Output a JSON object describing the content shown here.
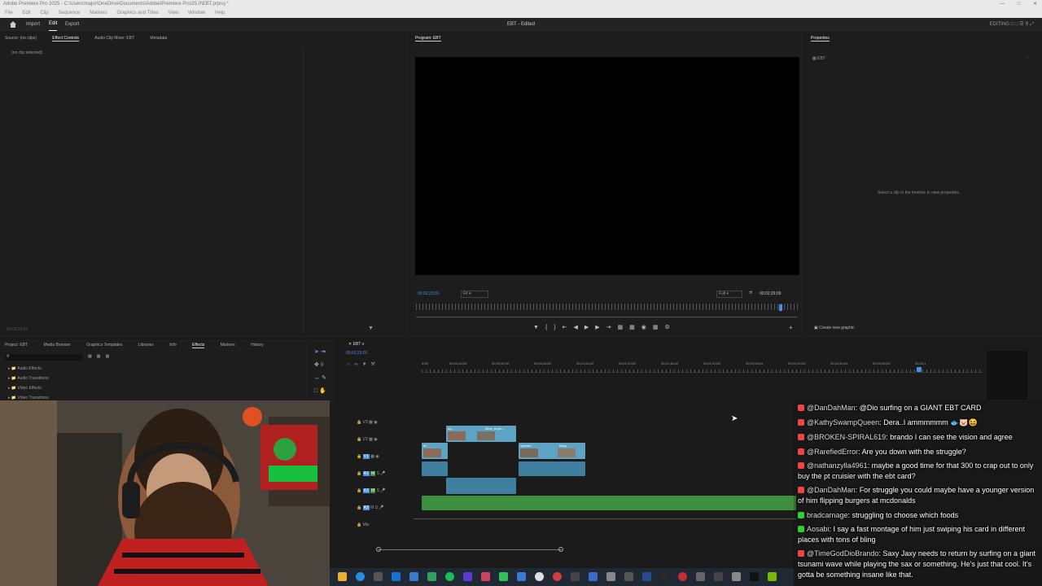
{
  "window": {
    "title": "Adobe Premiere Pro 2025 - C:\\Users\\major\\OneDrive\\Documents\\Adobe\\Premiere Pro\\25.0\\EBT.prproj *",
    "menu": [
      "File",
      "Edit",
      "Clip",
      "Sequence",
      "Markers",
      "Graphics and Titles",
      "View",
      "Window",
      "Help"
    ]
  },
  "workspace": {
    "tabs": [
      "Import",
      "Edit",
      "Export"
    ],
    "doc_title": "EBT - Edited",
    "right_label": "EDITING"
  },
  "source_panel": {
    "tabs": [
      "Source: (no clips)",
      "Effect Controls",
      "Audio Clip Mixer: EBT",
      "Metadata"
    ],
    "active_tab": "Effect Controls",
    "empty_text": "(no clip selected)",
    "timecode": "00;02;23;01"
  },
  "program_monitor": {
    "label": "Program: EBT",
    "timecode_left": "00;02;23;01",
    "fit": "Fit",
    "quality": "Full",
    "timecode_right": "00;02;29;09"
  },
  "properties_panel": {
    "label": "Properties",
    "item": "EBT",
    "hint": "Select a clip in the timeline to view properties.",
    "create_graphic": "Create new graphic"
  },
  "project_panel": {
    "tabs": [
      "Project: EBT",
      "Media Browser",
      "Graphics Templates",
      "Libraries",
      "Info",
      "Effects",
      "Markers",
      "History"
    ],
    "active_tab": "Effects",
    "folders": [
      "Audio Effects",
      "Audio Transitions",
      "Video Effects",
      "Video Transitions"
    ]
  },
  "timeline": {
    "sequence": "EBT",
    "timecode": "00;02;23;01",
    "ruler": [
      "0:00",
      "00;00;16;00",
      "00;00;32;00",
      "00;00;48;02",
      "00;01;04;02",
      "00;01;20;02",
      "00;01;36;02",
      "00;01;52;02",
      "00;02;08;04",
      "00;02;24;04",
      "00;02;40;04",
      "00;02;56;04",
      "00;03;1"
    ],
    "tracks": [
      "V3",
      "V2",
      "V1",
      "A1",
      "A2",
      "A3",
      "Mix"
    ],
    "clips": [
      {
        "label": "op...",
        "track": "V2"
      },
      {
        "label": "Mine_buyin...",
        "track": "V2"
      },
      {
        "label": "M...",
        "track": "V1"
      },
      {
        "label": "opensh...",
        "track": "V1"
      },
      {
        "label": "bling...",
        "track": "V1"
      }
    ]
  },
  "chat": {
    "messages": [
      {
        "badge": "#e44",
        "user": "@DanDahMan",
        "text": "@Dio surfing on a GIANT EBT CARD"
      },
      {
        "badge": "#e44",
        "user": "@KathySwampQueen",
        "text": "Dera..I ammmmmm 🐟🐷😆"
      },
      {
        "badge": "#e44",
        "user": "@BROKEN-SPIRAL619",
        "text": "brando I can see the vision and agree"
      },
      {
        "badge": "#e44",
        "user": "@RarefiedError",
        "text": "Are you down with the struggle?"
      },
      {
        "badge": "#e44",
        "user": "@nathanzylla4961",
        "text": "maybe a good time for that 300 to crap out to only buy the pt cruisier with the ebt card?"
      },
      {
        "badge": "#e44",
        "user": "@DanDahMan",
        "text": "For struggle you could maybe have a younger version of him flipping burgers at mcdonalds"
      },
      {
        "badge": "#3c3",
        "user": "bradcarnage",
        "text": "struggling to choose which foods"
      },
      {
        "badge": "#3c3",
        "user": "Aosabi",
        "text": "I say a fast montage of him just swiping his card in different places with tons of bling"
      },
      {
        "badge": "#e44",
        "user": "@TimeGodDioBrando",
        "text": "Saxy Jaxy needs to return by surfing on a giant tsunami wave while playing the sax or something. He's just that cool. It's gotta be something insane like that."
      }
    ]
  },
  "colors": {
    "accent": "#4a8fe7",
    "video_clip": "#5fa3c4",
    "audio_clip": "#3d8f3d"
  }
}
